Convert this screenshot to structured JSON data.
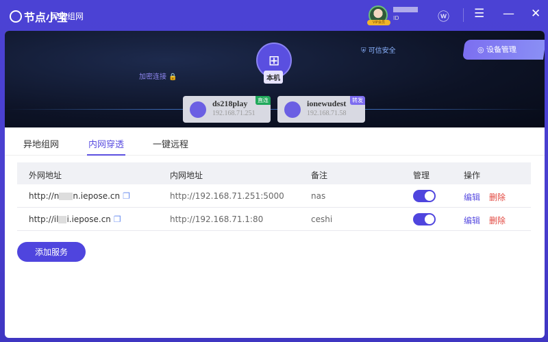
{
  "app": {
    "name": "节点小宝",
    "subtitle": "异地组网",
    "user_id": "ID",
    "vip": "VIP会员"
  },
  "banner": {
    "local_label": "本机",
    "encrypted": "加密连接",
    "trusted": "可信安全",
    "device_manage": "设备管理",
    "nodes": [
      {
        "name": "ds218play",
        "ip": "192.168.71.251",
        "tag": "直连",
        "tag_color": "#1fa85a"
      },
      {
        "name": "ionewudest",
        "ip": "192.168.71.58",
        "tag": "转发",
        "tag_color": "#7d6cf0"
      }
    ]
  },
  "tabs": [
    {
      "label": "异地组网"
    },
    {
      "label": "内网穿透",
      "active": true
    },
    {
      "label": "一键远程"
    }
  ],
  "table": {
    "headers": [
      "外网地址",
      "内网地址",
      "备注",
      "管理",
      "操作"
    ],
    "rows": [
      {
        "ext_pre": "http://n",
        "ext_post": "n.iepose.cn",
        "internal": "http://192.168.71.251:5000",
        "note": "nas",
        "enabled": true,
        "edit": "编辑",
        "delete": "删除"
      },
      {
        "ext_pre": "http://il",
        "ext_post": "i.iepose.cn",
        "internal": "http://192.168.71.1:80",
        "note": "ceshi",
        "enabled": true,
        "edit": "编辑",
        "delete": "删除"
      }
    ]
  },
  "add_button": "添加服务"
}
